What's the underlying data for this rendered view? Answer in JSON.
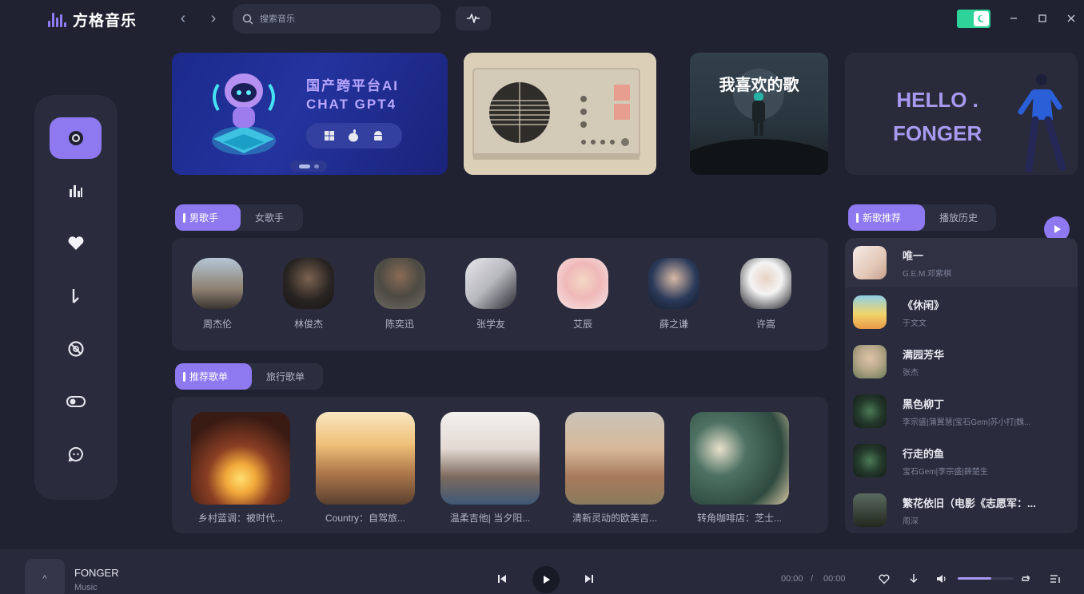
{
  "app": {
    "title": "方格音乐"
  },
  "search": {
    "placeholder": "搜索音乐"
  },
  "theme": {
    "toggle_on": true,
    "accent": "#8e79f0",
    "toggle_color": "#2ed39a"
  },
  "sidebar": {
    "items": [
      {
        "name": "discover",
        "icon": "disc-icon",
        "active": true
      },
      {
        "name": "charts",
        "icon": "bar-chart-icon"
      },
      {
        "name": "favorites",
        "icon": "heart-icon"
      },
      {
        "name": "download",
        "icon": "download-arrow-icon"
      },
      {
        "name": "vinyl",
        "icon": "no-disc-icon"
      },
      {
        "name": "toggle",
        "icon": "toggle-icon"
      },
      {
        "name": "chat",
        "icon": "chat-bubble-icon"
      }
    ]
  },
  "banners": {
    "ai": {
      "line1": "国产跨平台AI",
      "line2": "CHAT GPT4",
      "platforms": [
        "windows-icon",
        "apple-icon",
        "android-icon"
      ]
    },
    "radio": {},
    "favorite": {
      "title": "我喜欢的歌"
    },
    "hello": {
      "line1": "HELLO .",
      "line2": "FONGER"
    }
  },
  "singer_tabs": [
    "男歌手",
    "女歌手"
  ],
  "singers": [
    "周杰伦",
    "林俊杰",
    "陈奕迅",
    "张学友",
    "艾辰",
    "薛之谦",
    "许嵩"
  ],
  "playlist_tabs": [
    "推荐歌单",
    "旅行歌单"
  ],
  "playlists": [
    "乡村蓝调：被时代...",
    "Country：自驾旅...",
    "温柔吉他| 当夕阳...",
    "清新灵动的欧美吉...",
    "转角咖啡店：芝士..."
  ],
  "right_tabs": [
    "新歌推荐",
    "播放历史"
  ],
  "songs": [
    {
      "title": "唯一",
      "artist": "G.E.M.邓紫棋"
    },
    {
      "title": "《休闲》",
      "artist": "于文文"
    },
    {
      "title": "满园芳华",
      "artist": "张杰"
    },
    {
      "title": "黑色柳丁",
      "artist": "李宗盛|蒲翼慧|宝石Gem|苏小打|魏..."
    },
    {
      "title": "行走的鱼",
      "artist": "宝石Gem|李宗盛|薛楚生"
    },
    {
      "title": "繁花依旧（电影《志愿军：...",
      "artist": "周深"
    }
  ],
  "player": {
    "title": "FONGER",
    "subtitle": "Music",
    "thumb_label": "^",
    "current_time": "00:00",
    "separator": "/",
    "total_time": "00:00",
    "volume": 0.6
  }
}
